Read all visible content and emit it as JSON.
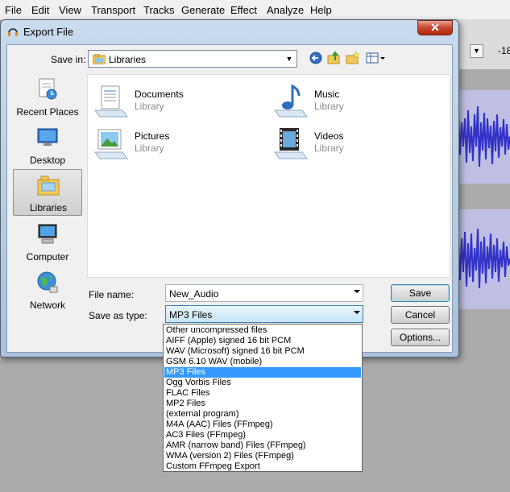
{
  "app": {
    "menu": [
      "File",
      "Edit",
      "View",
      "Transport",
      "Tracks",
      "Generate",
      "Effect",
      "Analyze",
      "Help"
    ],
    "meter_label": "-18"
  },
  "dialog": {
    "title": "Export File",
    "close": "✕",
    "save_in_label": "Save in:",
    "save_in_value": "Libraries",
    "places": [
      {
        "label": "Recent Places",
        "icon": "recent-places-icon"
      },
      {
        "label": "Desktop",
        "icon": "desktop-icon"
      },
      {
        "label": "Libraries",
        "icon": "libraries-icon"
      },
      {
        "label": "Computer",
        "icon": "computer-icon"
      },
      {
        "label": "Network",
        "icon": "network-icon"
      }
    ],
    "selected_place": "Libraries",
    "files": [
      {
        "name": "Documents",
        "sub": "Library",
        "icon": "documents-library-icon"
      },
      {
        "name": "Music",
        "sub": "Library",
        "icon": "music-library-icon"
      },
      {
        "name": "Pictures",
        "sub": "Library",
        "icon": "pictures-library-icon"
      },
      {
        "name": "Videos",
        "sub": "Library",
        "icon": "videos-library-icon"
      }
    ],
    "file_name_label": "File name:",
    "file_name_value": "New_Audio",
    "save_type_label": "Save as type:",
    "save_type_value": "MP3 Files",
    "buttons": {
      "save": "Save",
      "cancel": "Cancel",
      "options": "Options..."
    },
    "type_options": [
      "Other uncompressed files",
      "AIFF (Apple) signed 16 bit PCM",
      "WAV (Microsoft) signed 16 bit PCM",
      "GSM 6.10 WAV (mobile)",
      "MP3 Files",
      "Ogg Vorbis Files",
      "FLAC Files",
      "MP2 Files",
      "(external program)",
      "M4A (AAC) Files (FFmpeg)",
      "AC3 Files (FFmpeg)",
      "AMR (narrow band) Files (FFmpeg)",
      "WMA (version 2) Files (FFmpeg)",
      "Custom FFmpeg Export"
    ],
    "selected_type_index": 4
  },
  "colors": {
    "selection": "#3399ff",
    "waveform": "#3232c8",
    "close_button": "#c8452d"
  }
}
